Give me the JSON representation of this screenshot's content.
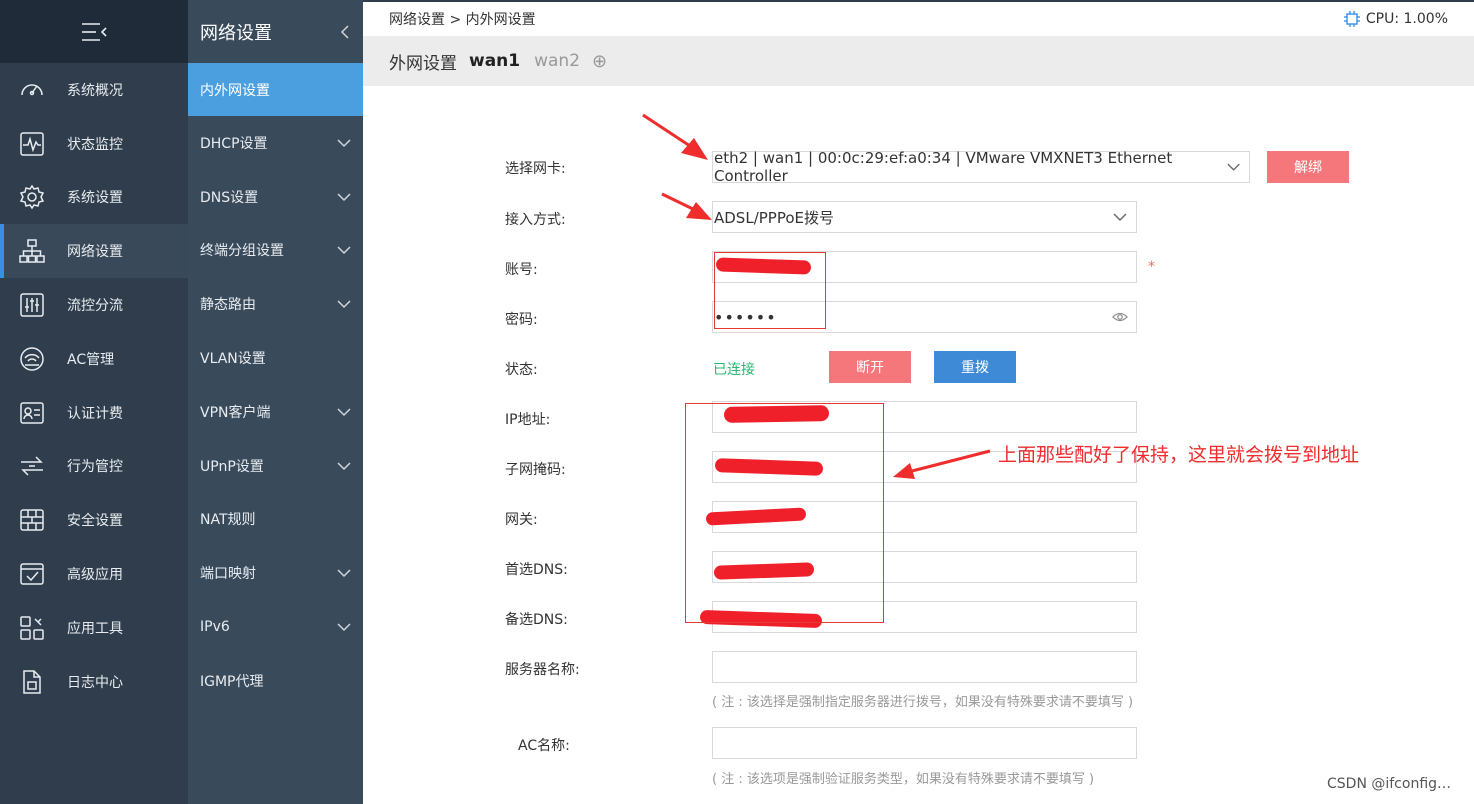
{
  "sidebar": {
    "items": [
      {
        "label": "系统概况",
        "icon": "dashboard-icon"
      },
      {
        "label": "状态监控",
        "icon": "monitor-icon"
      },
      {
        "label": "系统设置",
        "icon": "gear-icon"
      },
      {
        "label": "网络设置",
        "icon": "network-icon",
        "active": true
      },
      {
        "label": "流控分流",
        "icon": "sliders-icon"
      },
      {
        "label": "AC管理",
        "icon": "wifi-router-icon"
      },
      {
        "label": "认证计费",
        "icon": "id-card-icon"
      },
      {
        "label": "行为管控",
        "icon": "transfer-icon"
      },
      {
        "label": "安全设置",
        "icon": "firewall-icon"
      },
      {
        "label": "高级应用",
        "icon": "checklist-icon"
      },
      {
        "label": "应用工具",
        "icon": "tools-icon"
      },
      {
        "label": "日志中心",
        "icon": "document-icon"
      }
    ]
  },
  "subnav": {
    "title": "网络设置",
    "items": [
      {
        "label": "内外网设置",
        "active": true,
        "expand": false
      },
      {
        "label": "DHCP设置",
        "expand": true
      },
      {
        "label": "DNS设置",
        "expand": true
      },
      {
        "label": "终端分组设置",
        "expand": true
      },
      {
        "label": "静态路由",
        "expand": true
      },
      {
        "label": "VLAN设置",
        "expand": false
      },
      {
        "label": "VPN客户端",
        "expand": true
      },
      {
        "label": "UPnP设置",
        "expand": true
      },
      {
        "label": "NAT规则",
        "expand": false
      },
      {
        "label": "端口映射",
        "expand": true
      },
      {
        "label": "IPv6",
        "expand": true
      },
      {
        "label": "IGMP代理",
        "expand": false
      }
    ]
  },
  "topbar": {
    "breadcrumb": "网络设置 > 内外网设置",
    "cpu": "CPU: 1.00%"
  },
  "tabs": {
    "title": "外网设置",
    "active": "wan1",
    "inactive": "wan2",
    "add": "⊕"
  },
  "form": {
    "nic_label": "选择网卡:",
    "nic_value": "eth2 | wan1 | 00:0c:29:ef:a0:34 | VMware VMXNET3 Ethernet Controller",
    "unbind_label": "解绑",
    "mode_label": "接入方式:",
    "mode_value": "ADSL/PPPoE拨号",
    "account_label": "账号:",
    "account_value": "",
    "required_mark": "*",
    "password_label": "密码:",
    "password_value": "••••••",
    "status_label": "状态:",
    "status_value": "已连接",
    "disconnect_label": "断开",
    "redial_label": "重拨",
    "ip_label": "IP地址:",
    "mask_label": "子网掩码:",
    "gateway_label": "网关:",
    "dns1_label": "首选DNS:",
    "dns2_label": "备选DNS:",
    "server_label": "服务器名称:",
    "server_note": "( 注 :  该选择是强制指定服务器进行拨号，如果没有特殊要求请不要填写 )",
    "ac_label": "AC名称:",
    "ac_note": "( 注 :  该选项是强制验证服务类型，如果没有特殊要求请不要填写 )"
  },
  "annotation": {
    "text": "上面那些配好了保持，这里就会拨号到地址"
  },
  "watermark": "CSDN @ifconfig…",
  "colors": {
    "sidebar_bg": "#2f3d4c",
    "subnav_bg": "#394a5b",
    "active_blue": "#4c9fde",
    "danger_red": "#f5777c",
    "primary_blue": "#3f8ad6",
    "success_green": "#2bb673",
    "annotation_red": "#e53935"
  }
}
